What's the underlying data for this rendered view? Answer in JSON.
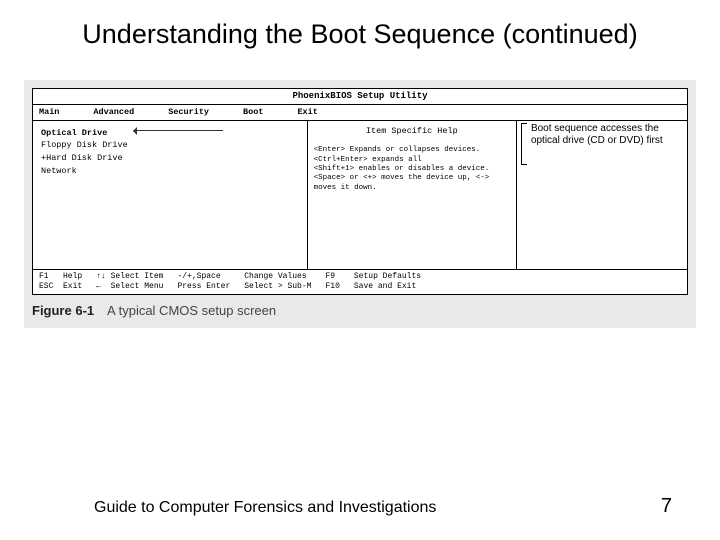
{
  "slide": {
    "title": "Understanding the Boot Sequence (continued)"
  },
  "bios": {
    "util_title": "PhoenixBIOS Setup Utility",
    "tabs": [
      "Main",
      "Advanced",
      "Security",
      "Boot",
      "Exit"
    ],
    "boot_items": [
      "Optical Drive",
      "Floppy Disk Drive",
      "+Hard Disk Drive",
      "Network"
    ],
    "help_title": "Item Specific Help",
    "help_text": "<Enter> Expands or collapses devices.\n<Ctrl+Enter> expands all\n<Shift+1> enables or disables a device.\n<Space> or <+> moves the device up, <-> moves it down.",
    "callout": "Boot sequence accesses the optical drive (CD or DVD) first",
    "footer": {
      "c1": "F1   Help\nESC  Exit",
      "c2": "↑↓ Select Item\n←  Select Menu",
      "c3": "-/+,Space\nPress Enter",
      "c4": "Change Values\nSelect > Sub-M",
      "c5": "F9\nF10",
      "c6": "Setup Defaults\nSave and Exit"
    }
  },
  "figure": {
    "number": "Figure 6-1",
    "caption": "A typical CMOS setup screen"
  },
  "footer": {
    "book": "Guide to Computer Forensics and Investigations",
    "page": "7"
  }
}
